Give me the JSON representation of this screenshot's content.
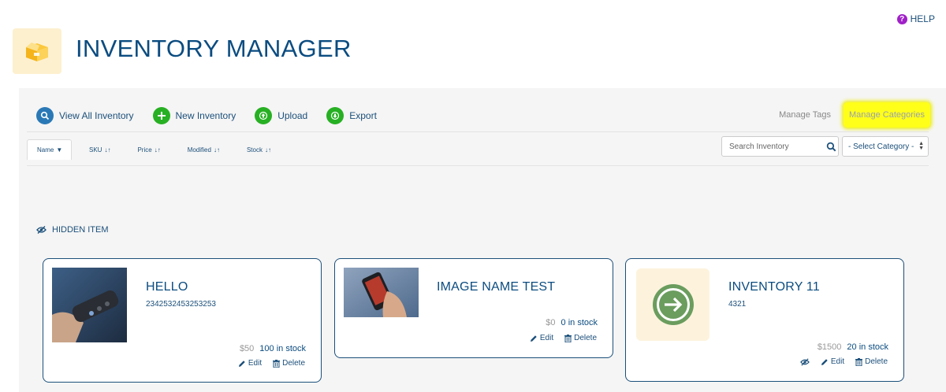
{
  "header": {
    "title": "INVENTORY MANAGER",
    "help_label": "HELP"
  },
  "toolbar": {
    "view_all_label": "View All Inventory",
    "new_label": "New Inventory",
    "upload_label": "Upload",
    "export_label": "Export",
    "manage_tags_label": "Manage Tags",
    "manage_categories_label": "Manage Categories"
  },
  "sort_tabs": [
    {
      "label": "Name"
    },
    {
      "label": "SKU"
    },
    {
      "label": "Price"
    },
    {
      "label": "Modified"
    },
    {
      "label": "Stock"
    }
  ],
  "search": {
    "placeholder": "Search Inventory"
  },
  "category_select": {
    "selected": "- Select Category -"
  },
  "hidden_item_label": "HIDDEN ITEM",
  "cards": [
    {
      "name": "HELLO",
      "sku": "2342532453253253",
      "price": "$50",
      "stock": "100 in stock",
      "edit_label": "Edit",
      "delete_label": "Delete"
    },
    {
      "name": "IMAGE NAME TEST",
      "sku": "",
      "price": "$0",
      "stock": "0 in stock",
      "edit_label": "Edit",
      "delete_label": "Delete"
    },
    {
      "name": "INVENTORY 11",
      "sku": "4321",
      "price": "$1500",
      "stock": "20 in stock",
      "edit_label": "Edit",
      "delete_label": "Delete"
    }
  ],
  "colors": {
    "primary": "#0b4c80",
    "blue_button": "#2a79b6",
    "green_button": "#27b023",
    "highlight": "#ffff1a",
    "help_icon": "#a020c8"
  },
  "icons": {
    "logo": "open-box-icon",
    "view_all": "search-icon",
    "new": "plus-icon",
    "upload": "upload-icon",
    "export": "download-icon",
    "hidden": "eye-slash-icon",
    "edit": "pencil-icon",
    "delete": "trash-icon"
  }
}
